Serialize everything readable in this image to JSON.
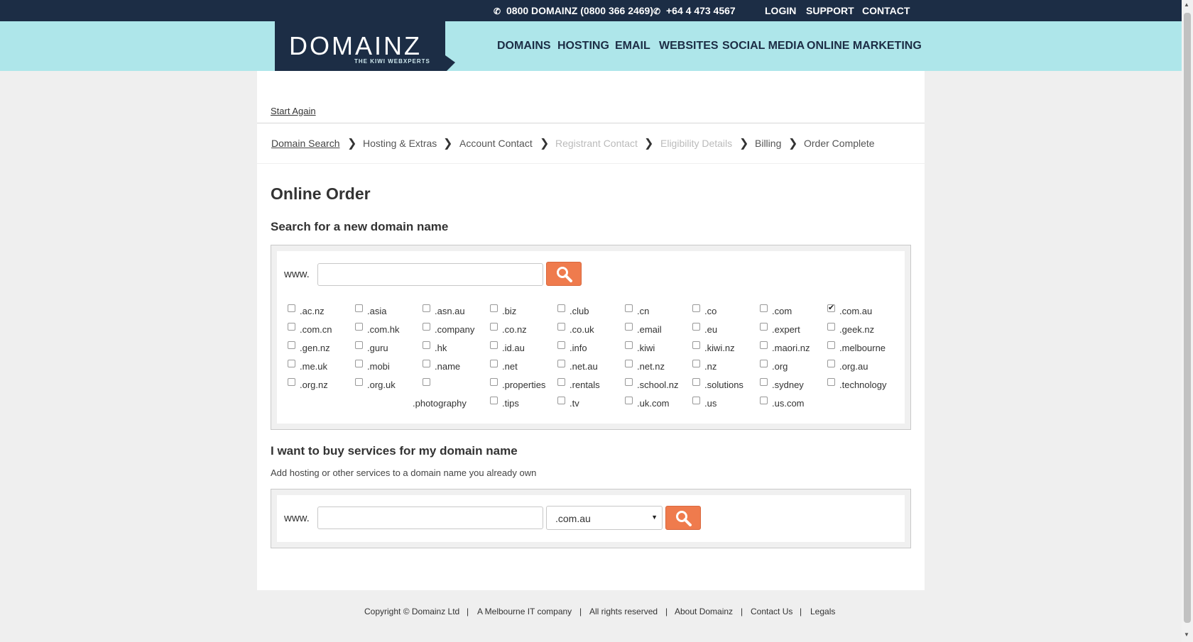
{
  "topbar": {
    "phone1": "0800 DOMAINZ (0800 366 2469)",
    "phone2": "+64 4 473 4567",
    "login": "LOGIN",
    "support": "SUPPORT",
    "contact": "CONTACT"
  },
  "logo": {
    "word": "DOMAINZ",
    "tag": "THE KIWI WEBXPERTS"
  },
  "nav": [
    "DOMAINS",
    "HOSTING",
    "EMAIL",
    "WEBSITES",
    "SOCIAL MEDIA",
    "ONLINE MARKETING"
  ],
  "start_again": "Start Again",
  "steps": [
    "Domain Search",
    "Hosting & Extras",
    "Account Contact",
    "Registrant Contact",
    "Eligibility Details",
    "Billing",
    "Order Complete"
  ],
  "page_title": "Online Order",
  "search_section": {
    "heading": "Search for a new domain name",
    "prefix": "www.",
    "input_value": "",
    "tlds": [
      {
        "label": ".ac.nz",
        "checked": false
      },
      {
        "label": ".asia",
        "checked": false
      },
      {
        "label": ".asn.au",
        "checked": false
      },
      {
        "label": ".biz",
        "checked": false
      },
      {
        "label": ".club",
        "checked": false
      },
      {
        "label": ".cn",
        "checked": false
      },
      {
        "label": ".co",
        "checked": false
      },
      {
        "label": ".com",
        "checked": false
      },
      {
        "label": ".com.au",
        "checked": true
      },
      {
        "label": ".com.cn",
        "checked": false
      },
      {
        "label": ".com.hk",
        "checked": false
      },
      {
        "label": ".company",
        "checked": false
      },
      {
        "label": ".co.nz",
        "checked": false
      },
      {
        "label": ".co.uk",
        "checked": false
      },
      {
        "label": ".email",
        "checked": false
      },
      {
        "label": ".eu",
        "checked": false
      },
      {
        "label": ".expert",
        "checked": false
      },
      {
        "label": ".geek.nz",
        "checked": false
      },
      {
        "label": ".gen.nz",
        "checked": false
      },
      {
        "label": ".guru",
        "checked": false
      },
      {
        "label": ".hk",
        "checked": false
      },
      {
        "label": ".id.au",
        "checked": false
      },
      {
        "label": ".info",
        "checked": false
      },
      {
        "label": ".kiwi",
        "checked": false
      },
      {
        "label": ".kiwi.nz",
        "checked": false
      },
      {
        "label": ".maori.nz",
        "checked": false
      },
      {
        "label": ".melbourne",
        "checked": false
      },
      {
        "label": ".me.uk",
        "checked": false
      },
      {
        "label": ".mobi",
        "checked": false
      },
      {
        "label": ".name",
        "checked": false
      },
      {
        "label": ".net",
        "checked": false
      },
      {
        "label": ".net.au",
        "checked": false
      },
      {
        "label": ".net.nz",
        "checked": false
      },
      {
        "label": ".nz",
        "checked": false
      },
      {
        "label": ".org",
        "checked": false
      },
      {
        "label": ".org.au",
        "checked": false
      },
      {
        "label": ".org.nz",
        "checked": false
      },
      {
        "label": ".org.uk",
        "checked": false
      },
      {
        "label": ".photography",
        "checked": false
      },
      {
        "label": ".properties",
        "checked": false
      },
      {
        "label": ".rentals",
        "checked": false
      },
      {
        "label": ".school.nz",
        "checked": false
      },
      {
        "label": ".solutions",
        "checked": false
      },
      {
        "label": ".sydney",
        "checked": false
      },
      {
        "label": ".technology",
        "checked": false
      },
      {
        "label": ".tips",
        "checked": false
      },
      {
        "label": ".tv",
        "checked": false
      },
      {
        "label": ".uk.com",
        "checked": false
      },
      {
        "label": ".us",
        "checked": false
      },
      {
        "label": ".us.com",
        "checked": false
      }
    ]
  },
  "services_section": {
    "heading": "I want to buy services for my domain name",
    "subtext": "Add hosting or other services to a domain name you already own",
    "prefix": "www.",
    "input_value": "",
    "selected_tld": ".com.au"
  },
  "footer": [
    "Copyright © Domainz Ltd",
    "A Melbourne IT company",
    "All rights reserved",
    "About Domainz",
    "Contact Us",
    "Legals"
  ],
  "colors": {
    "navy": "#1c2d45",
    "aqua": "#aee6ea",
    "search_orange": "#ef7b4d"
  }
}
